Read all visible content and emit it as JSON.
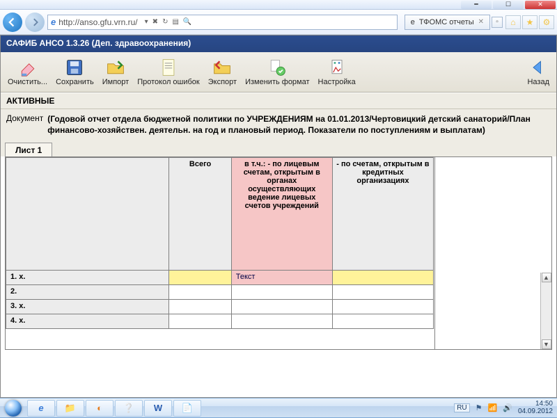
{
  "browser": {
    "address": "http://anso.gfu.vrn.ru/",
    "tab_title": "ТФОМС отчеты"
  },
  "app": {
    "title": "САФИБ АНСО 1.3.26 (Деп. здравоохранения)"
  },
  "toolbar": {
    "clear": "Очистить...",
    "save": "Сохранить",
    "import": "Импорт",
    "protocol": "Протокол ошибок",
    "export": "Экспорт",
    "change_format": "Изменить формат",
    "settings": "Настройка",
    "back": "Назад"
  },
  "section": {
    "active": "АКТИВНЫЕ",
    "doc_label": "Документ",
    "doc_text": "(Годовой отчет отдела бюджетной политики по УЧРЕЖДЕНИЯМ на 01.01.2013/Чертовицкий детский санаторий/План финансово-хозяйствен. деятельн. на год и плановый период. Показатели по поступлениям и выплатам)"
  },
  "tabs": {
    "sheet1": "Лист 1"
  },
  "grid": {
    "headers": {
      "c0": "",
      "c1": "Всего",
      "c2": "в т.ч.: - по лицевым счетам, открытым в органах осуществляющих ведение лицевых счетов учреждений",
      "c3": "- по счетам, открытым в кредитных организациях"
    },
    "rows": [
      {
        "num": "1. x.",
        "c2": "Текст"
      },
      {
        "num": "2."
      },
      {
        "num": "3. x."
      },
      {
        "num": "4. x."
      }
    ]
  },
  "taskbar": {
    "lang": "RU",
    "time": "14:50",
    "date": "04.09.2012"
  }
}
